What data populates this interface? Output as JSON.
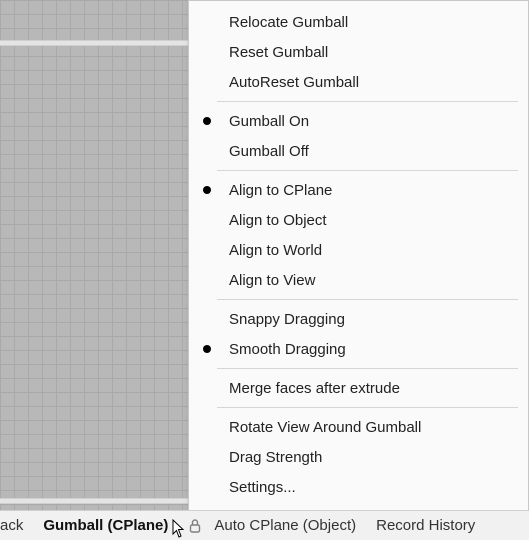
{
  "menu": {
    "items": [
      {
        "label": "Relocate Gumball",
        "checked": false
      },
      {
        "label": "Reset Gumball",
        "checked": false
      },
      {
        "label": "AutoReset Gumball",
        "checked": false
      },
      {
        "label": "Gumball On",
        "checked": true
      },
      {
        "label": "Gumball Off",
        "checked": false
      },
      {
        "label": "Align to CPlane",
        "checked": true
      },
      {
        "label": "Align to Object",
        "checked": false
      },
      {
        "label": "Align to World",
        "checked": false
      },
      {
        "label": "Align to View",
        "checked": false
      },
      {
        "label": "Snappy Dragging",
        "checked": false
      },
      {
        "label": "Smooth Dragging",
        "checked": true
      },
      {
        "label": "Merge faces after extrude",
        "checked": false
      },
      {
        "label": "Rotate View Around Gumball",
        "checked": false
      },
      {
        "label": "Drag Strength",
        "checked": false
      },
      {
        "label": "Settings...",
        "checked": false
      }
    ]
  },
  "statusbar": {
    "partial_item": "ack",
    "gumball": "Gumball (CPlane)",
    "auto_cplane": "Auto CPlane (Object)",
    "record_history": "Record History"
  }
}
